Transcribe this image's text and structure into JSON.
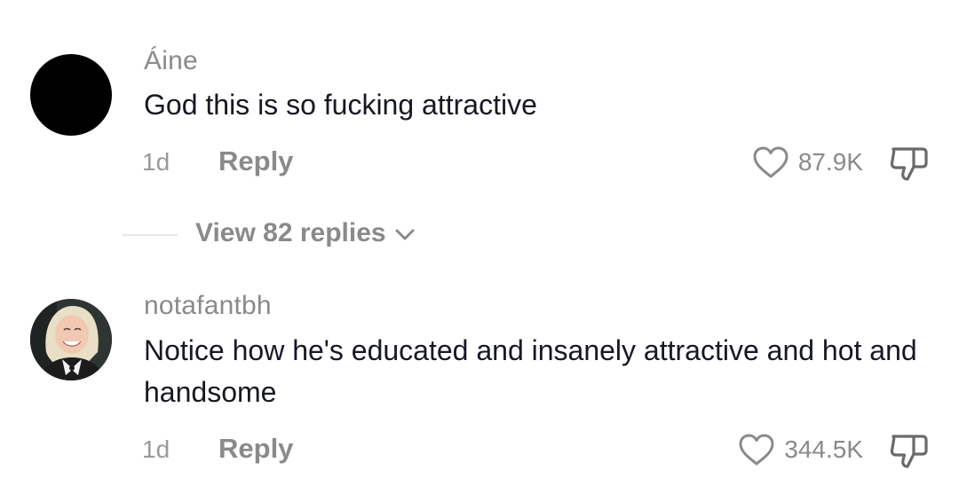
{
  "comments": [
    {
      "username": "Áine",
      "text": "God this is so fucking attractive",
      "time": "1d",
      "reply_label": "Reply",
      "like_count": "87.9K",
      "avatar": "avatar-black",
      "replies": {
        "label": "View 82 replies",
        "icon": "chevron-down-icon"
      }
    },
    {
      "username": "notafantbh",
      "text": "Notice how he's educated and insanely attractive and hot and handsome",
      "time": "1d",
      "reply_label": "Reply",
      "like_count": "344.5K",
      "avatar": "avatar-photo"
    }
  ],
  "icons": {
    "like": "heart-icon",
    "dislike": "thumbs-down-icon"
  },
  "colors": {
    "primary_text": "#161823",
    "secondary_text": "#8a8a8a",
    "background": "#ffffff"
  }
}
